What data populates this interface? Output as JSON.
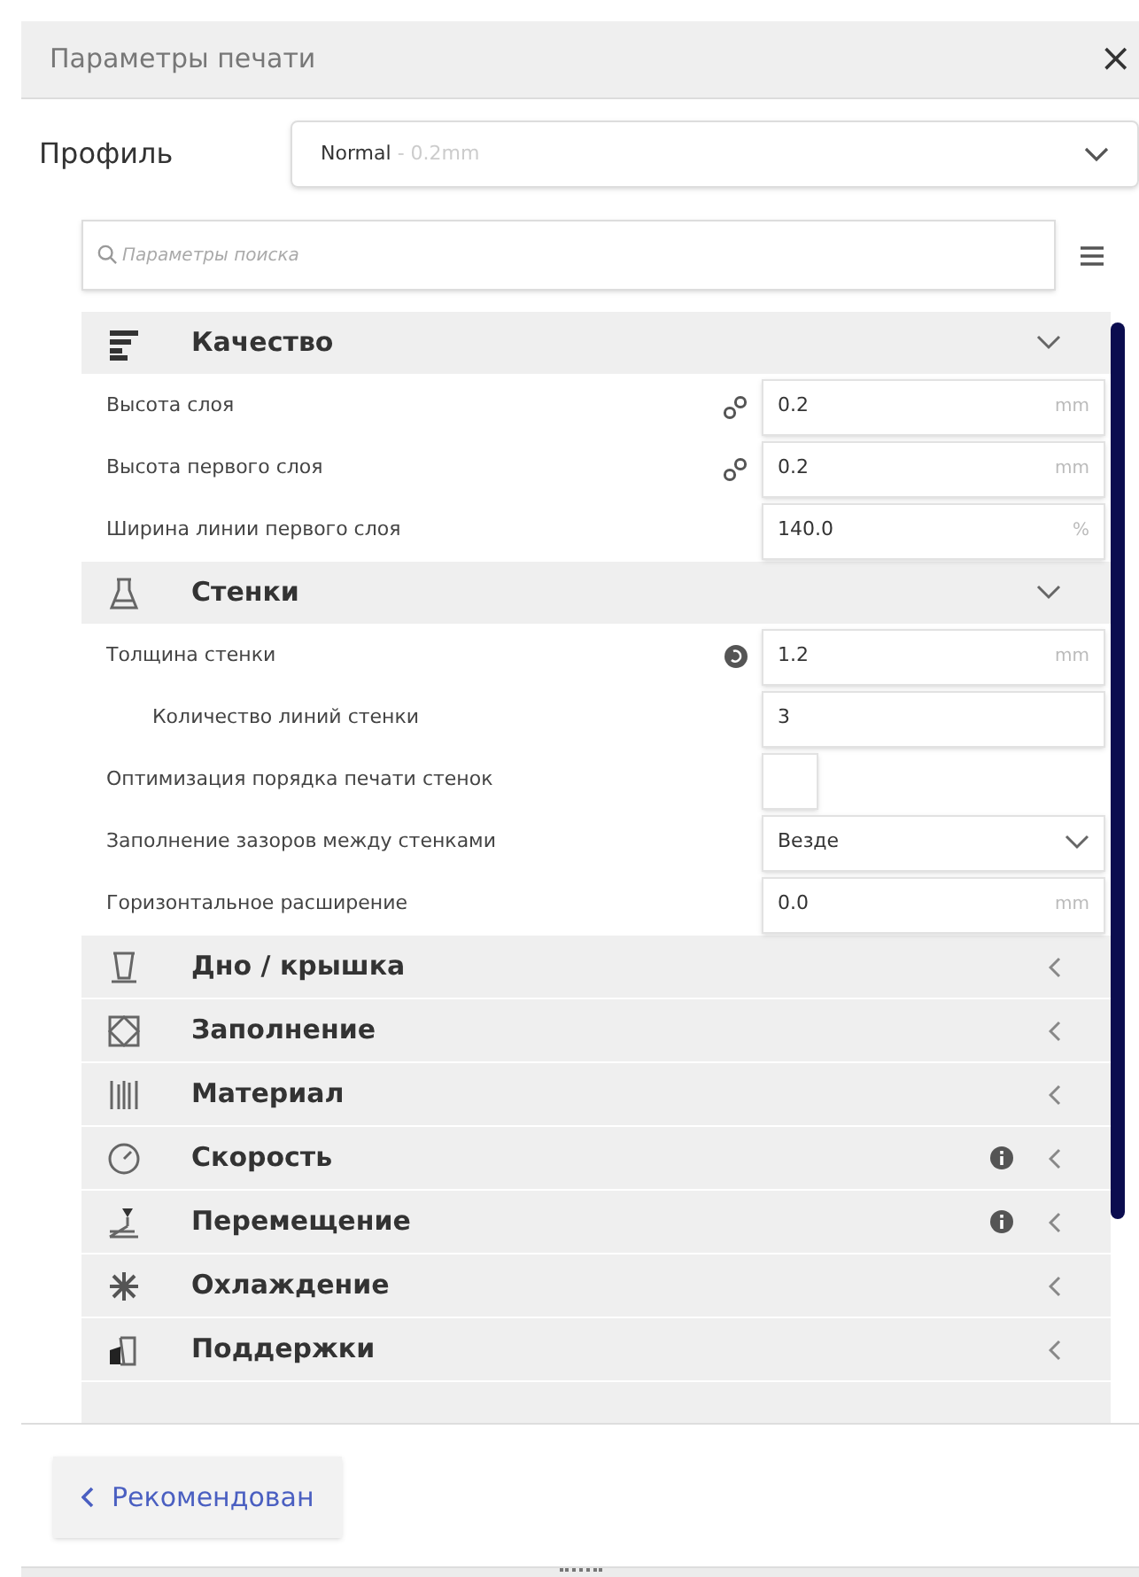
{
  "window": {
    "title": "Параметры печати",
    "close": "×"
  },
  "profile": {
    "label": "Профиль",
    "value": "Normal",
    "detail": "- 0.2mm"
  },
  "search": {
    "placeholder": "Параметры поиска"
  },
  "categories": [
    {
      "kind": "quality",
      "label": "Качество",
      "expanded": true,
      "info": false,
      "settings": [
        {
          "kind": "input",
          "label": "Высота слоя",
          "child": false,
          "linked": true,
          "value": "0.2",
          "unit": "mm"
        },
        {
          "kind": "input",
          "label": "Высота первого слоя",
          "child": false,
          "linked": true,
          "value": "0.2",
          "unit": "mm"
        },
        {
          "kind": "input",
          "label": "Ширина линии первого слоя",
          "child": false,
          "linked": false,
          "value": "140.0",
          "unit": "%"
        }
      ]
    },
    {
      "kind": "walls",
      "label": "Стенки",
      "expanded": true,
      "info": false,
      "settings": [
        {
          "kind": "input",
          "label": "Толщина стенки",
          "child": false,
          "linked": false,
          "reset": true,
          "value": "1.2",
          "unit": "mm"
        },
        {
          "kind": "input",
          "label": "Количество линий стенки",
          "child": true,
          "linked": false,
          "value": "3"
        },
        {
          "kind": "checkbox",
          "label": "Оптимизация порядка печати стенок",
          "child": false,
          "linked": false,
          "checked": false
        },
        {
          "kind": "select",
          "label": "Заполнение зазоров между стенками",
          "child": false,
          "linked": false,
          "value": "Везде"
        },
        {
          "kind": "input",
          "label": "Горизонтальное расширение",
          "child": false,
          "linked": false,
          "value": "0.0",
          "unit": "mm"
        }
      ]
    },
    {
      "kind": "topbottom",
      "label": "Дно / крышка",
      "expanded": false,
      "info": false
    },
    {
      "kind": "infill",
      "label": "Заполнение",
      "expanded": false,
      "info": false
    },
    {
      "kind": "material",
      "label": "Материал",
      "expanded": false,
      "info": false
    },
    {
      "kind": "speed",
      "label": "Скорость",
      "expanded": false,
      "info": true
    },
    {
      "kind": "travel",
      "label": "Перемещение",
      "expanded": false,
      "info": true
    },
    {
      "kind": "cooling",
      "label": "Охлаждение",
      "expanded": false,
      "info": false
    },
    {
      "kind": "support",
      "label": "Поддержки",
      "expanded": false,
      "info": false
    }
  ],
  "recommended_button": "Рекомендован"
}
